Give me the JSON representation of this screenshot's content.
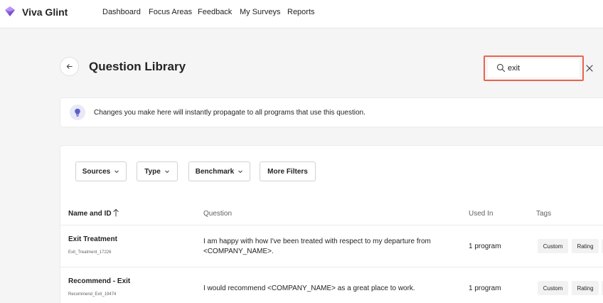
{
  "app": {
    "brand": "Viva Glint"
  },
  "nav": {
    "items": [
      "Dashboard",
      "Focus Areas",
      "Feedback",
      "My Surveys",
      "Reports"
    ]
  },
  "page": {
    "title": "Question Library"
  },
  "search": {
    "value": "exit",
    "placeholder": ""
  },
  "banner": {
    "text": "Changes you make here will instantly propagate to all programs that use this question."
  },
  "filters": {
    "sources": "Sources",
    "type": "Type",
    "benchmark": "Benchmark",
    "more": "More Filters"
  },
  "table": {
    "headers": {
      "name": "Name and ID",
      "question": "Question",
      "used": "Used In",
      "tags": "Tags"
    },
    "rows": [
      {
        "name": "Exit Treatment",
        "id": "Exit_Treatment_17226",
        "question": "I am happy with how I've been treated with respect to my departure from <COMPANY_NAME>.",
        "used": "1 program",
        "tags": [
          "Custom",
          "Rating"
        ]
      },
      {
        "name": "Recommend - Exit",
        "id": "Recommend_Exit_19474",
        "question": "I would recommend <COMPANY_NAME> as a great place to work.",
        "used": "1 program",
        "tags": [
          "Custom",
          "Rating"
        ]
      }
    ]
  },
  "colors": {
    "accent": "#7b5cd6",
    "highlight": "#e8654f",
    "info": "#5b5fc7"
  },
  "icons": {
    "logo": "viva-glint-logo",
    "back": "arrow-left-icon",
    "search": "search-icon",
    "close": "close-icon",
    "bulb": "lightbulb-icon",
    "sort": "arrow-up-icon",
    "chevron": "chevron-down-icon"
  }
}
